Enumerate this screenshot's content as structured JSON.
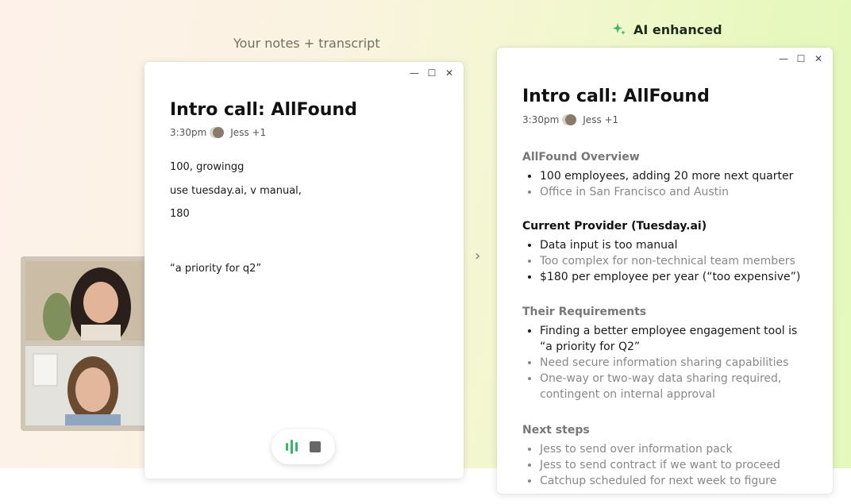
{
  "captions": {
    "left": "Your notes + transcript",
    "right": "AI enhanced"
  },
  "left_window": {
    "title": "Intro call: AllFound",
    "time": "3:30pm",
    "attendees": "Jess +1",
    "notes": [
      "100, growingg",
      "use tuesday.ai, v manual,",
      "180",
      "“a priority for q2”"
    ]
  },
  "right_window": {
    "title": "Intro call: AllFound",
    "time": "3:30pm",
    "attendees": "Jess +1",
    "sections": [
      {
        "heading": "AllFound Overview",
        "items": [
          "100 employees, adding 20 more next quarter",
          "Office in San Francisco and Austin"
        ]
      },
      {
        "heading": "Current Provider (Tuesday.ai)",
        "items": [
          "Data input is too manual",
          "Too complex for non-technical team members",
          "$180 per employee per year (“too expensive”)"
        ]
      },
      {
        "heading": "Their Requirements",
        "items": [
          "Finding a better employee engagement tool is “a priority for Q2”",
          "Need secure information sharing capabilities",
          "One-way or two-way data sharing required, contingent on internal approval"
        ]
      },
      {
        "heading": "Next steps",
        "items": [
          "Jess to send over information pack",
          "Jess to send contract if we want to proceed",
          "Catchup scheduled for next week to figure"
        ]
      }
    ]
  },
  "colors": {
    "accent_green": "#39b56a"
  }
}
